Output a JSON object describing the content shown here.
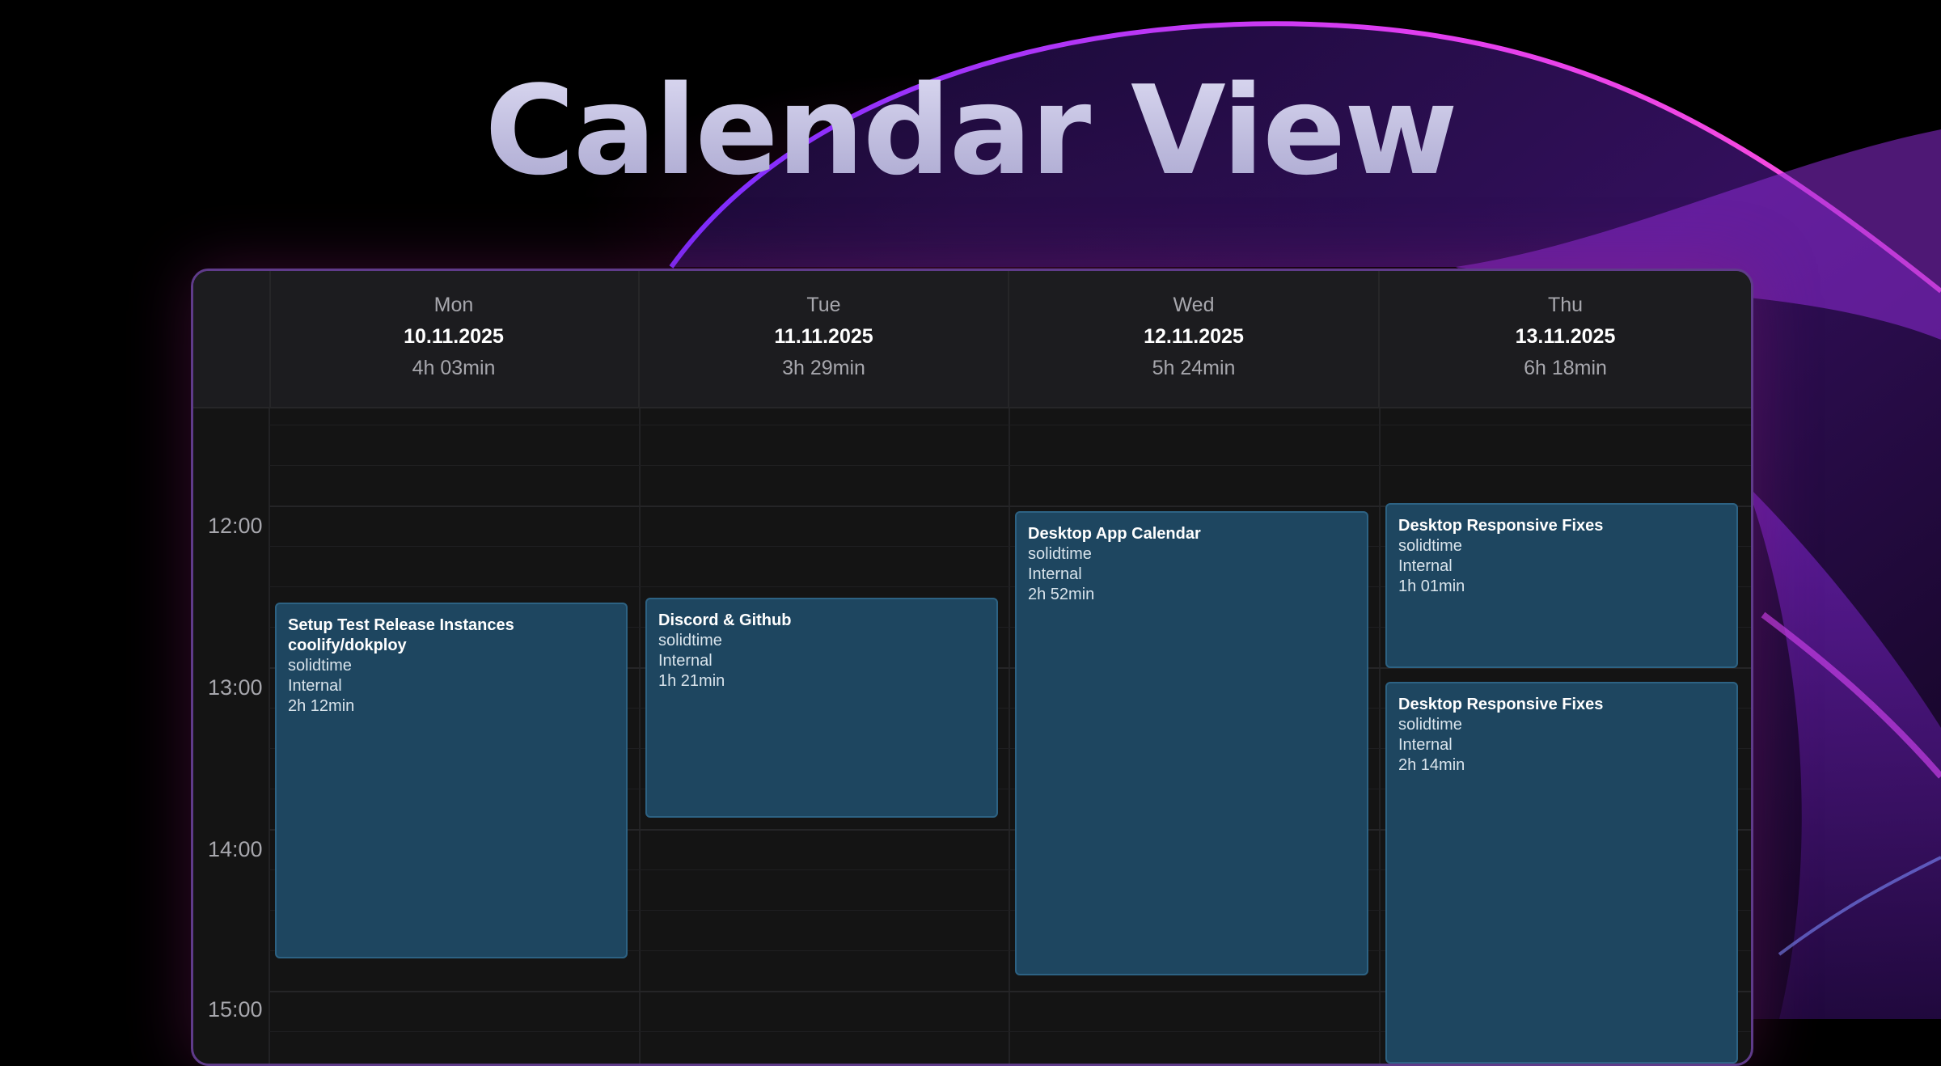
{
  "title": "Calendar View",
  "days": [
    {
      "name": "Mon",
      "date": "10.11.2025",
      "total": "4h 03min"
    },
    {
      "name": "Tue",
      "date": "11.11.2025",
      "total": "3h 29min"
    },
    {
      "name": "Wed",
      "date": "12.11.2025",
      "total": "5h 24min"
    },
    {
      "name": "Thu",
      "date": "13.11.2025",
      "total": "6h 18min"
    }
  ],
  "times": [
    "12:00",
    "13:00",
    "14:00",
    "15:00"
  ],
  "events": [
    {
      "title": "Setup Test Release Instances coolify/dokploy",
      "project": "solidtime",
      "client": "Internal",
      "duration": "2h 12min"
    },
    {
      "title": "Discord & Github",
      "project": "solidtime",
      "client": "Internal",
      "duration": "1h 21min"
    },
    {
      "title": "Desktop App Calendar",
      "project": "solidtime",
      "client": "Internal",
      "duration": "2h 52min"
    },
    {
      "title": "Desktop Responsive Fixes",
      "project": "solidtime",
      "client": "Internal",
      "duration": "1h 01min"
    },
    {
      "title": "Desktop Responsive Fixes",
      "project": "solidtime",
      "client": "Internal",
      "duration": "2h 14min"
    }
  ],
  "colors": {
    "event_fill": "#1e4660",
    "event_border": "#2d6283",
    "panel_border": "#5f3b8a",
    "accent_magenta": "#d13be8"
  }
}
